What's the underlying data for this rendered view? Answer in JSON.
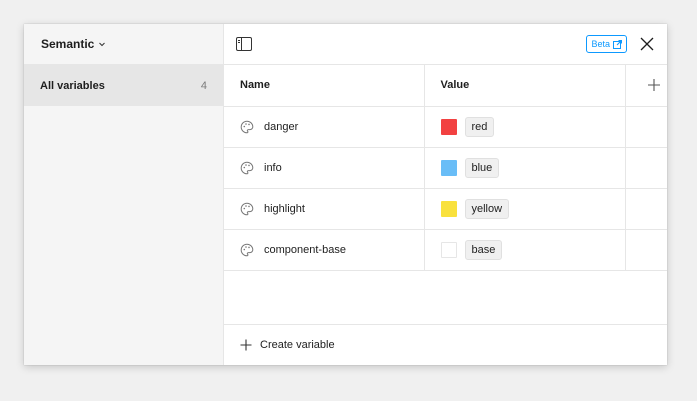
{
  "sidebar": {
    "collection_name": "Semantic",
    "items": [
      {
        "label": "All variables",
        "count": "4"
      }
    ]
  },
  "topbar": {
    "beta_label": "Beta"
  },
  "table": {
    "headers": {
      "name": "Name",
      "value": "Value"
    },
    "rows": [
      {
        "name": "danger",
        "swatch": "#f24141",
        "value": "red"
      },
      {
        "name": "info",
        "swatch": "#69bdf7",
        "value": "blue"
      },
      {
        "name": "highlight",
        "swatch": "#f9e13d",
        "value": "yellow"
      },
      {
        "name": "component-base",
        "swatch": "#ffffff",
        "value": "base"
      }
    ]
  },
  "footer": {
    "create_label": "Create variable"
  },
  "icons": {
    "panel": "sidebar-toggle-icon",
    "close": "close-icon",
    "add_column": "plus-icon",
    "variable": "palette-icon",
    "external": "external-link-icon"
  }
}
